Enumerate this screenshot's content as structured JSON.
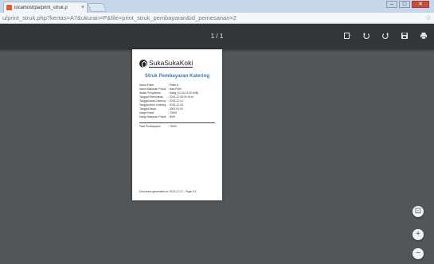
{
  "browser": {
    "tab_title": "localhost/pa/print_struk.p",
    "tab_close": "×",
    "url": "u/print_struk.php?kertas=A7&ukuran=P&file=print_struk_pembayaran&id_pemesanan=2",
    "window_buttons": [
      "–",
      "□",
      "✕"
    ]
  },
  "pdf_toolbar": {
    "page_indicator": "1 / 1",
    "tools": [
      "bookmark-icon",
      "rotate-ccw-icon",
      "rotate-cw-icon",
      "save-icon",
      "print-icon"
    ]
  },
  "document": {
    "logo_text": "SukaSukaKoki",
    "title": "Struk Pembayaran Katering",
    "rows": [
      {
        "label": "Nama Paket",
        "value": ": Paket A"
      },
      {
        "label": "Nama Makanan Pokok",
        "value": ": Nasi Putih"
      },
      {
        "label": "Waktu Pengiriman",
        "value": ": Siang (12.00-13.30 WIB)"
      },
      {
        "label": "Tanggal Pemesanan",
        "value": ": 2015-12-08 00:15:xx"
      },
      {
        "label": "Tanggal Awal Catering",
        "value": ": 2015-12-14"
      },
      {
        "label": "Tanggal Akhir Catering",
        "value": ": 2015-12-18"
      },
      {
        "label": "Tanggal Bayar",
        "value": ": 0000-00-00"
      },
      {
        "label": "Harga Paket",
        "value": ": 70000"
      },
      {
        "label": "Harga Makanan Pokok",
        "value": ": 5000"
      }
    ],
    "total": {
      "label": "Total Pembayaran",
      "value": ": 75000"
    },
    "footer": "Document generated on 2015-12-12 - Page 1/1"
  },
  "zoom_controls": {
    "fit": "⊡",
    "zoom_in": "+",
    "zoom_out": "−"
  }
}
